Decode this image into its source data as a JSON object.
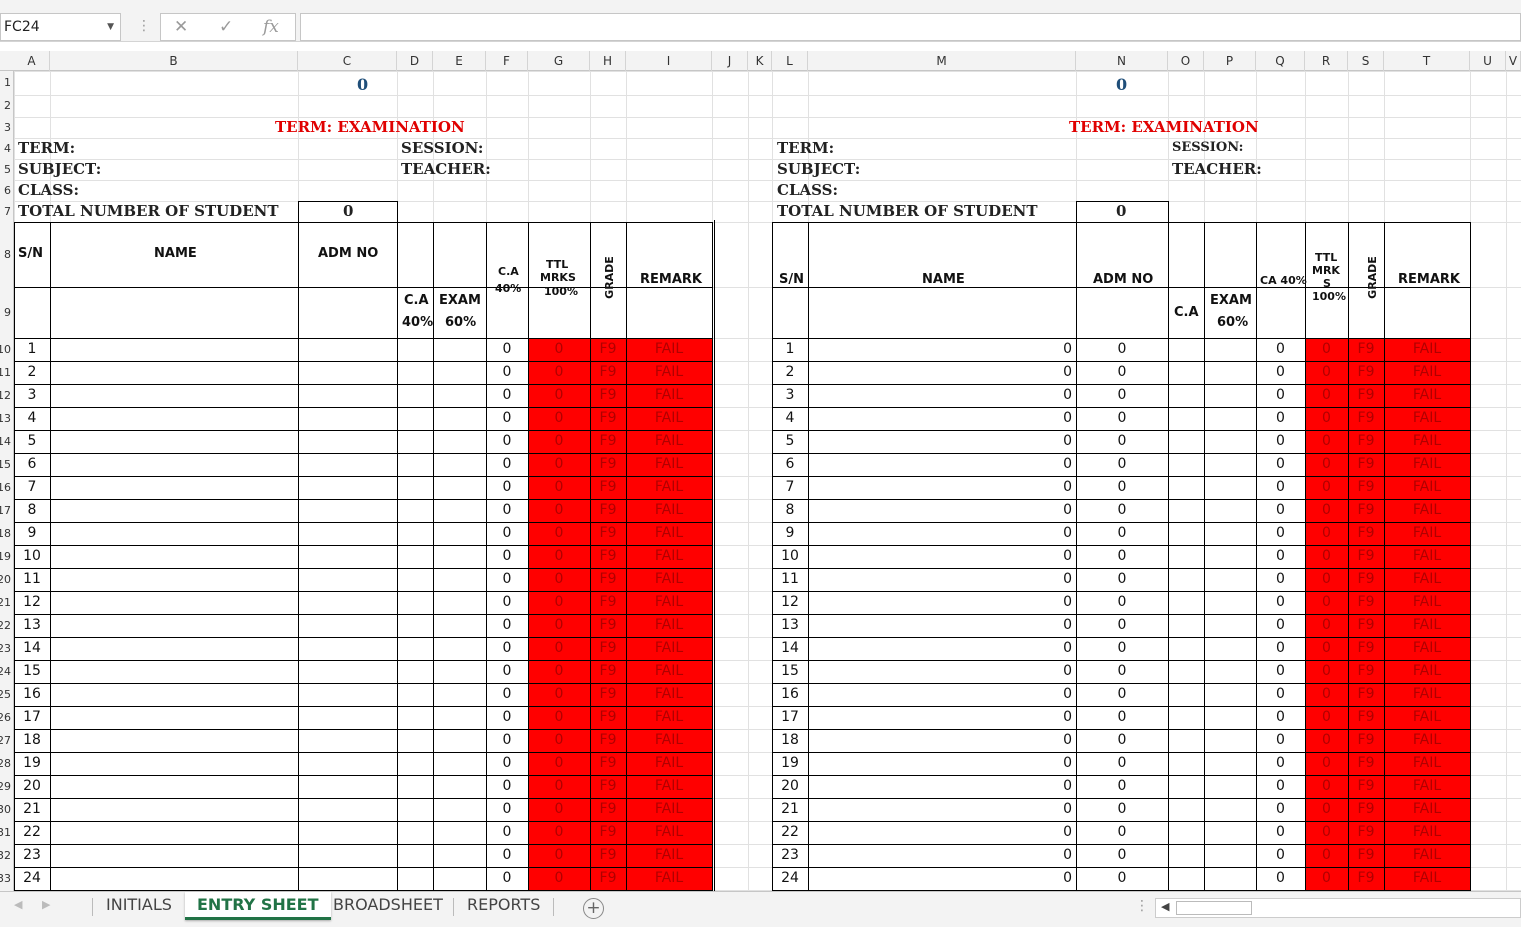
{
  "formula_bar": {
    "name_box": "FC24",
    "cancel": "✕",
    "enter": "✓",
    "fx": "fx",
    "formula": ""
  },
  "columns": [
    "A",
    "B",
    "C",
    "D",
    "E",
    "F",
    "G",
    "H",
    "I",
    "J",
    "K",
    "L",
    "M",
    "N",
    "O",
    "P",
    "Q",
    "R",
    "S",
    "T",
    "U",
    "V"
  ],
  "rows": [
    "1",
    "2",
    "3",
    "4",
    "5",
    "6",
    "7",
    "8",
    "9",
    "10",
    "11",
    "12",
    "13",
    "14",
    "15",
    "16",
    "17",
    "18",
    "19",
    "20",
    "21",
    "22",
    "23",
    "24",
    "25",
    "26",
    "27",
    "28",
    "29",
    "30",
    "31",
    "32",
    "33"
  ],
  "left_sheet": {
    "top_value": "0",
    "title": "TERM: EXAMINATION",
    "term": "TERM:",
    "subject": "SUBJECT:",
    "class": "CLASS:",
    "total_label": "TOTAL NUMBER OF STUDENT",
    "total_value": "0",
    "session": "SESSION:",
    "teacher": "TEACHER:",
    "h_sn": "S/N",
    "h_name": "NAME",
    "h_adm": "ADM NO",
    "h_ca": "C.A",
    "h_ca_pct": "40%",
    "h_exam": "EXAM",
    "h_exam_pct": "60%",
    "h_ca2": "C.A",
    "h_ca2_pct": "40%",
    "h_ttl": "TTL",
    "h_ttl2": "MRKS",
    "h_ttl3": "100%",
    "h_grade": "GRADE",
    "h_remark": "REMARK"
  },
  "right_sheet": {
    "top_value": "0",
    "title": "TERM: EXAMINATION",
    "term": "TERM:",
    "subject": "SUBJECT:",
    "class": "CLASS:",
    "total_label": "TOTAL NUMBER OF STUDENT",
    "total_value": "0",
    "session": "SESSION:",
    "teacher": "TEACHER:",
    "h_sn": "S/N",
    "h_name": "NAME",
    "h_adm": "ADM NO",
    "h_ca": "C.A",
    "h_exam": "EXAM",
    "h_exam_pct": "60%",
    "h_ca40": "CA 40%",
    "h_ttl": "TTL",
    "h_ttl2": "MRK",
    "h_ttl3": "S",
    "h_ttl4": "100%",
    "h_grade": "GRADE",
    "h_remark": "REMARK"
  },
  "students": [
    "1",
    "2",
    "3",
    "4",
    "5",
    "6",
    "7",
    "8",
    "9",
    "10",
    "11",
    "12",
    "13",
    "14",
    "15",
    "16",
    "17",
    "18",
    "19",
    "20",
    "21",
    "22",
    "23",
    "24"
  ],
  "row_values": {
    "ca": "0",
    "ttl": "0",
    "grade": "F9",
    "remark": "FAIL",
    "name_value": "0",
    "adm_value": "0"
  },
  "colors": {
    "fail_fill": "#ff0000",
    "title_red": "#e00000",
    "header_blue": "#1f4e79",
    "tab_active": "#217346"
  },
  "sheet_tabs": [
    "INITIALS",
    "ENTRY SHEET",
    "BROADSHEET",
    "REPORTS"
  ],
  "active_tab": "ENTRY SHEET",
  "add_sheet": "+"
}
